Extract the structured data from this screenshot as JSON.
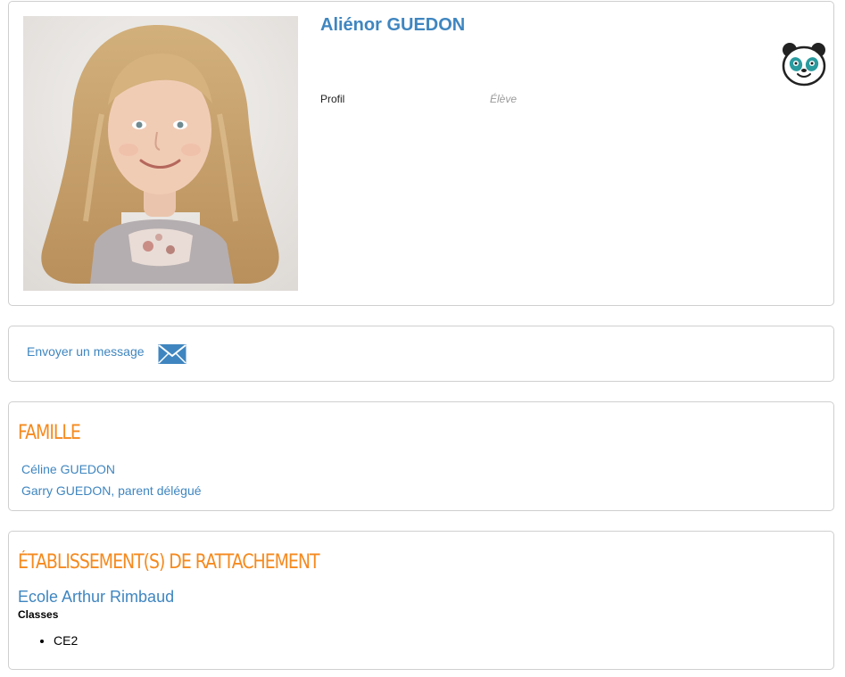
{
  "profile": {
    "name": "Aliénor GUEDON",
    "profile_label": "Profil",
    "profile_value": "Élève"
  },
  "actions": {
    "send_message": "Envoyer un message"
  },
  "family": {
    "title": "FAMILLE",
    "members": [
      "Céline GUEDON",
      "Garry GUEDON, parent délégué"
    ]
  },
  "schools": {
    "title": "ÉTABLISSEMENT(S) DE RATTACHEMENT",
    "name": "Ecole Arthur Rimbaud",
    "classes_label": "Classes",
    "classes": [
      "CE2"
    ]
  },
  "colors": {
    "link_blue": "#3f86c0",
    "section_orange": "#f58a1f",
    "card_border": "#cfcfcf"
  },
  "icons": [
    "panda-mascot-icon",
    "envelope-icon"
  ]
}
